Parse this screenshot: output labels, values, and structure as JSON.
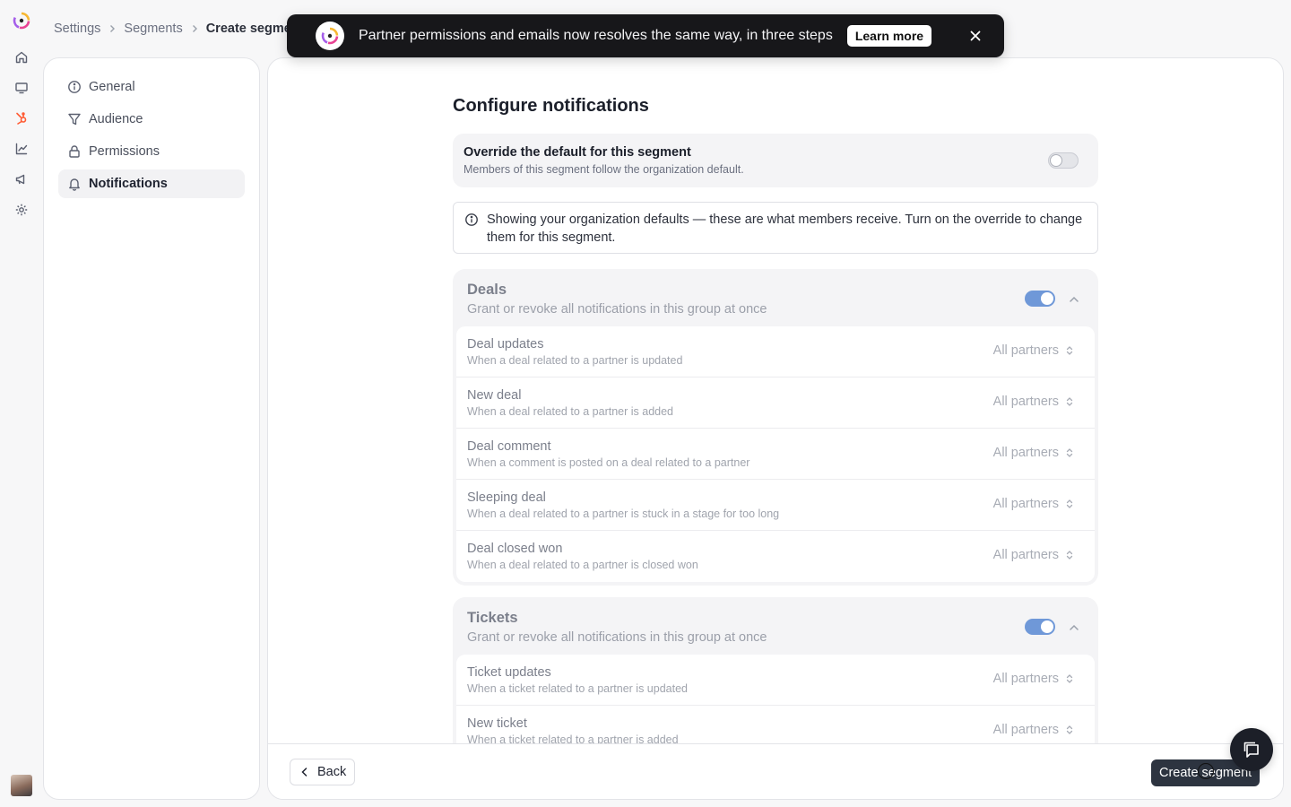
{
  "breadcrumb": {
    "items": [
      "Settings",
      "Segments"
    ],
    "current": "Create segment"
  },
  "toast": {
    "message": "Partner permissions and emails now resolves the same way, in three steps",
    "action_label": "Learn more"
  },
  "nav": {
    "items": [
      {
        "label": "General",
        "icon": "info-icon"
      },
      {
        "label": "Audience",
        "icon": "filter-icon"
      },
      {
        "label": "Permissions",
        "icon": "lock-icon"
      },
      {
        "label": "Notifications",
        "icon": "bell-icon",
        "active": true
      }
    ]
  },
  "page": {
    "title": "Configure notifications",
    "override": {
      "title": "Override the default for this segment",
      "subtitle": "Members of this segment follow the organization default.",
      "enabled": false
    },
    "info": "Showing your organization defaults — these are what members receive. Turn on the override to change them for this segment.",
    "groups": [
      {
        "title": "Deals",
        "subtitle": "Grant or revoke all notifications in this group at once",
        "enabled": true,
        "rows": [
          {
            "title": "Deal updates",
            "subtitle": "When a deal related to a partner is updated",
            "value": "All partners"
          },
          {
            "title": "New deal",
            "subtitle": "When a deal related to a partner is added",
            "value": "All partners"
          },
          {
            "title": "Deal comment",
            "subtitle": "When a comment is posted on a deal related to a partner",
            "value": "All partners"
          },
          {
            "title": "Sleeping deal",
            "subtitle": "When a deal related to a partner is stuck in a stage for too long",
            "value": "All partners"
          },
          {
            "title": "Deal closed won",
            "subtitle": "When a deal related to a partner is closed won",
            "value": "All partners"
          }
        ]
      },
      {
        "title": "Tickets",
        "subtitle": "Grant or revoke all notifications in this group at once",
        "enabled": true,
        "rows": [
          {
            "title": "Ticket updates",
            "subtitle": "When a ticket related to a partner is updated",
            "value": "All partners"
          },
          {
            "title": "New ticket",
            "subtitle": "When a ticket related to a partner is added",
            "value": "All partners"
          }
        ]
      }
    ]
  },
  "footer": {
    "back_label": "Back",
    "create_label": "Create segment"
  },
  "colors": {
    "accent": "#6f98d8",
    "primary_button": "#2d3440",
    "toast_bg": "#17171a",
    "brand_orange": "#ff5c35"
  }
}
